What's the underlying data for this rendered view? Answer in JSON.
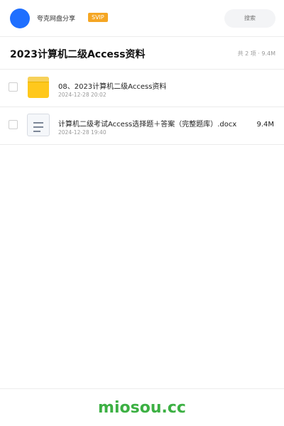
{
  "header": {
    "user_name": "夸克网盘分享",
    "badge": "SVIP",
    "search_placeholder": "搜索",
    "avatar_color": "#1f6fff"
  },
  "title_bar": {
    "title": "2023计算机二级Access资料",
    "summary": "共 2 项 · 9.4M"
  },
  "files": [
    {
      "type": "folder",
      "icon": "folder-icon",
      "name": "08、2023计算机二级Access资料",
      "date": "2024-12-28 20:02",
      "size": ""
    },
    {
      "type": "document",
      "icon": "document-icon",
      "name": "计算机二级考试Access选择题＋答案（完整题库）.docx",
      "date": "2024-12-28 19:40",
      "size": "9.4M"
    }
  ],
  "footer": {
    "brand": "miosou.cc",
    "brand_color": "#3cb043"
  }
}
